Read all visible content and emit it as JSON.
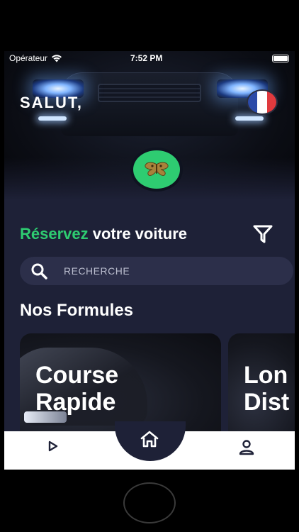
{
  "status_bar": {
    "carrier": "Opérateur",
    "time": "7:52 PM"
  },
  "header": {
    "greeting": "SALUT,",
    "language_flag": "french-flag-icon"
  },
  "booking": {
    "title_accent": "Réservez",
    "title_rest": " votre voiture"
  },
  "search": {
    "placeholder": "RECHERCHE"
  },
  "formulas": {
    "section_title": "Nos Formules",
    "cards": [
      {
        "title_line1": "Course",
        "title_line2": "Rapide"
      },
      {
        "title_line1": "Lon",
        "title_line2": "Dist"
      }
    ]
  },
  "tabbar": {
    "items": [
      "play-icon",
      "home-icon",
      "profile-icon"
    ]
  },
  "colors": {
    "accent": "#2ecc71",
    "background": "#1e2137",
    "search_bg": "#2c2f4a",
    "flag_blue": "#2b4aa8",
    "flag_white": "#ffffff",
    "flag_red": "#e03a3e"
  }
}
